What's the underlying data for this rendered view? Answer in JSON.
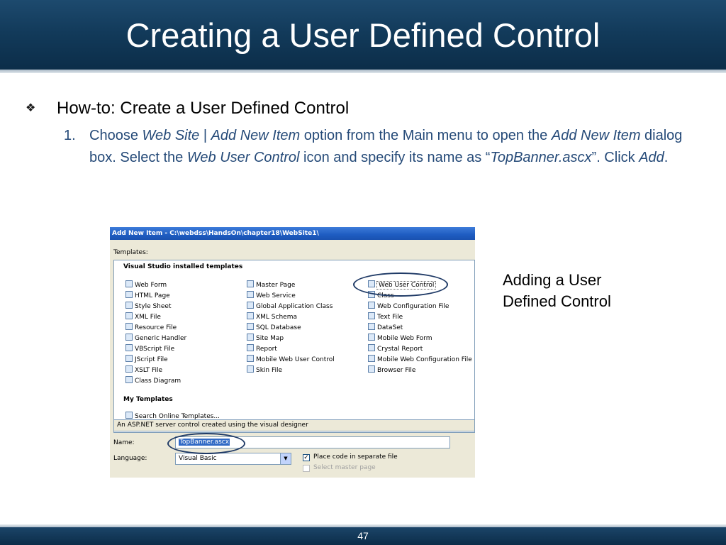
{
  "slide": {
    "title": "Creating a User Defined Control",
    "bullet": "How-to: Create a User Defined Control",
    "step_number": "1.",
    "caption": "Adding a User Defined Control",
    "page_number": "47"
  },
  "step_parts": {
    "p1": "Choose ",
    "i1": "Web Site",
    "p2": " | ",
    "i2": "Add New Item",
    "p3": " option from the Main menu to open the ",
    "i3": "Add New Item",
    "p4": " dialog box. Select the ",
    "i4": "Web User Control",
    "p5": " icon and specify its name as “",
    "i5": "TopBanner.ascx",
    "p6": "”. Click ",
    "i6": "Add",
    "p7": "."
  },
  "dialog": {
    "title": "Add New Item - C:\\webdss\\HandsOn\\chapter18\\WebSite1\\",
    "templates_label": "Templates:",
    "group_installed": "Visual Studio installed templates",
    "group_my": "My Templates",
    "col1": [
      "Web Form",
      "HTML Page",
      "Style Sheet",
      "XML File",
      "Resource File",
      "Generic Handler",
      "VBScript File",
      "JScript File",
      "XSLT File",
      "Class Diagram"
    ],
    "col2": [
      "Master Page",
      "Web Service",
      "Global Application Class",
      "XML Schema",
      "SQL Database",
      "Site Map",
      "Report",
      "Mobile Web User Control",
      "Skin File"
    ],
    "col3": [
      "Web User Control",
      "Class",
      "Web Configuration File",
      "Text File",
      "DataSet",
      "Mobile Web Form",
      "Crystal Report",
      "Mobile Web Configuration File",
      "Browser File"
    ],
    "my_templates_item": "Search Online Templates...",
    "description": "An ASP.NET server control created using the visual designer",
    "name_label": "Name:",
    "name_value": "TopBanner.ascx",
    "language_label": "Language:",
    "language_value": "Visual Basic",
    "check_separate": "Place code in separate file",
    "check_master": "Select master page"
  }
}
